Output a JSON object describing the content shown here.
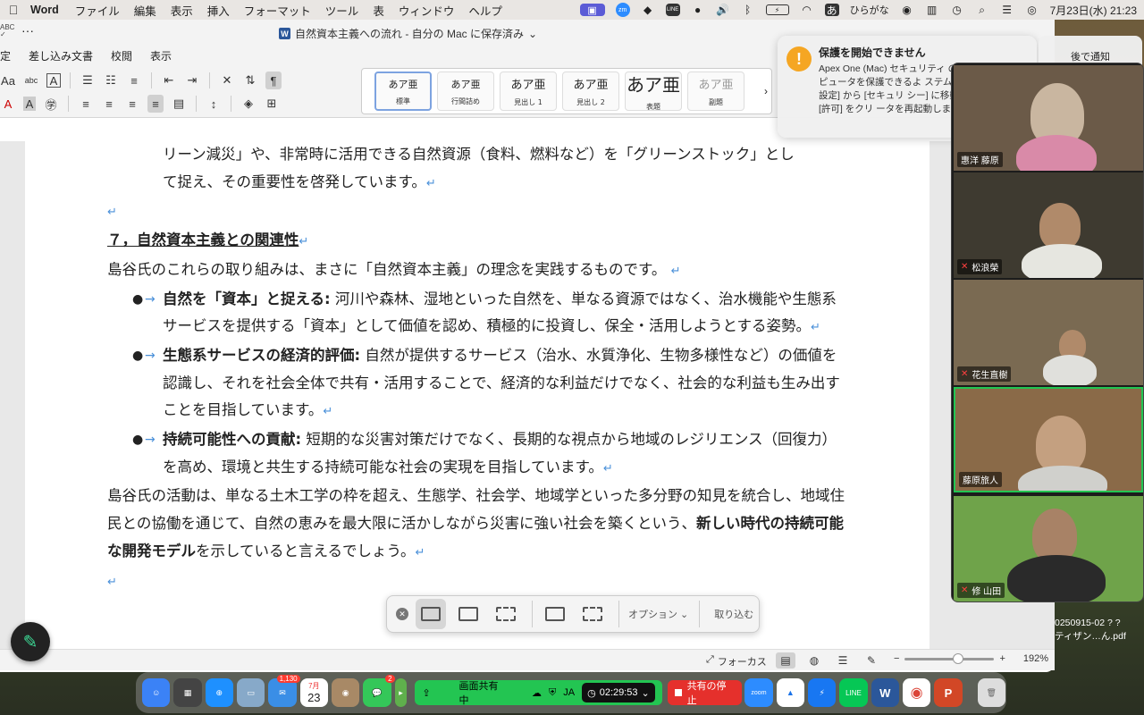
{
  "menubar": {
    "app": "Word",
    "items": [
      "ファイル",
      "編集",
      "表示",
      "挿入",
      "フォーマット",
      "ツール",
      "表",
      "ウィンドウ",
      "ヘルプ"
    ],
    "input_method": "ひらがな",
    "input_mode_char": "あ",
    "clock": "7月23日(水)  21:23"
  },
  "titlebar": {
    "doc_title": "自然資本主義への流れ - 自分の Mac に保存済み",
    "quick_label": "ABC"
  },
  "ribbon_tabs": [
    "定",
    "差し込み文書",
    "校閲",
    "表示"
  ],
  "styles": [
    {
      "sample": "あア亜",
      "name": "標準"
    },
    {
      "sample": "あア亜",
      "name": "行間詰め"
    },
    {
      "sample": "あア亜",
      "name": "見出し 1"
    },
    {
      "sample": "あア亜",
      "name": "見出し 2"
    },
    {
      "sample": "あア亜",
      "name": "表題"
    },
    {
      "sample": "あア亜",
      "name": "副題"
    }
  ],
  "document": {
    "line1": "リーン減災」や、非常時に活用できる自然資源（食料、燃料など）を「グリーンストック」とし",
    "line2": "て捉え、その重要性を啓発しています。",
    "heading": "７，自然資本主義との関連性",
    "intro": "島谷氏のこれらの取り組みは、まさに「自然資本主義」の理念を実践するものです。",
    "bullets": [
      {
        "title": "自然を「資本」と捉える:",
        "text": " 河川や森林、湿地といった自然を、単なる資源ではなく、治水機能や生態系サービスを提供する「資本」として価値を認め、積極的に投資し、保全・活用しようとする姿勢。"
      },
      {
        "title": "生態系サービスの経済的評価:",
        "text": " 自然が提供するサービス（治水、水質浄化、生物多様性など）の価値を認識し、それを社会全体で共有・活用することで、経済的な利益だけでなく、社会的な利益も生み出すことを目指しています。"
      },
      {
        "title": "持続可能性への貢献:",
        "text": " 短期的な災害対策だけでなく、長期的な視点から地域のレジリエンス（回復力）を高め、環境と共生する持続可能な社会の実現を目指しています。"
      }
    ],
    "closing_a": "島谷氏の活動は、単なる土木工学の枠を超え、生態学、社会学、地域学といった多分野の知見を統合し、地域住民との協働を通じて、自然の恵みを最大限に活かしながら災害に強い社会を築くという、",
    "closing_bold": "新しい時代の持続可能な開発モデル",
    "closing_b": "を示していると言えるでしょう。",
    "para_mark": "↵"
  },
  "statusbar": {
    "focus": "フォーカス",
    "zoom_level": "192%",
    "zoom_fraction": 0.6
  },
  "screenshot_toolbar": {
    "options": "オプション",
    "capture": "取り込む"
  },
  "notification": {
    "title": "保護を開始できません",
    "body": "Apex One (Mac) セキュリティ のコンピュータを保護できるよ ステム環境設定] から [セキュリ シー] に移動して [許可] をクリ ータを再起動します。",
    "later": "後で通知"
  },
  "participants": [
    {
      "name": "惠洋 藤原",
      "muted": false,
      "bg": "#6b5a48",
      "active": false
    },
    {
      "name": "松浪榮",
      "muted": true,
      "bg": "#4a4a3a",
      "active": false
    },
    {
      "name": "花生直樹",
      "muted": true,
      "bg": "#7a6a52",
      "active": false
    },
    {
      "name": "藤原旅人",
      "muted": false,
      "bg": "#8a6a48",
      "active": true
    },
    {
      "name": "修 山田",
      "muted": true,
      "bg": "#6fa34a",
      "active": false
    }
  ],
  "desktop_file": {
    "line1": "0250915-02 ? ?",
    "line2": "ティザン…ん.pdf"
  },
  "dock": {
    "mail_badge": "1,130",
    "messages_badge": "2",
    "calendar_month": "7月",
    "calendar_day": "23",
    "share_label": "画面共有中",
    "share_lang": "JA",
    "share_timer": "02:29:53",
    "stop_label": "共有の停止",
    "zoom_label": "zoom"
  }
}
